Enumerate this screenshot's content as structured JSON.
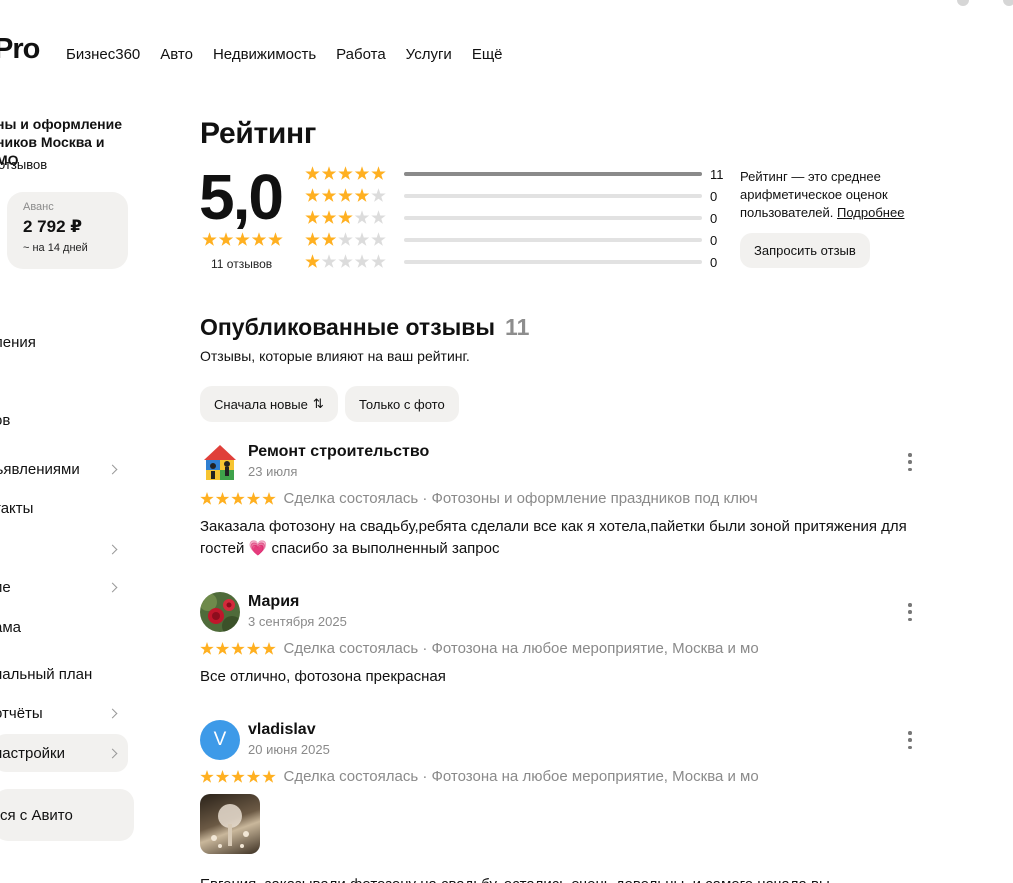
{
  "header": {
    "logo": "Pro",
    "nav": [
      "Бизнес360",
      "Авто",
      "Недвижимость",
      "Работа",
      "Услуги",
      "Ещё"
    ]
  },
  "sidebar": {
    "business_name": "ны и оформление ников Москва и МО",
    "reviews_count": "отзывов",
    "balance": {
      "label": "Аванс",
      "amount": "2 792 ₽",
      "note": "~ на 14 дней"
    },
    "items": [
      {
        "label": "ления",
        "chevron": false,
        "active": false
      },
      {
        "label": "ов",
        "chevron": false,
        "active": false
      },
      {
        "label": "ъявлениями",
        "chevron": true,
        "active": false
      },
      {
        "label": "такт ов",
        "chevron": false,
        "active": false
      },
      {
        "label": "",
        "chevron": true,
        "active": false
      },
      {
        "label": "ие",
        "chevron": true,
        "active": false
      },
      {
        "label": "ама",
        "chevron": false,
        "active": false
      },
      {
        "label": "нальный план",
        "chevron": false,
        "active": false
      },
      {
        "label": "отчёты",
        "chevron": true,
        "active": false
      },
      {
        "label": "настройки",
        "chevron": true,
        "active": true
      }
    ],
    "contact_button": "ся с Авито"
  },
  "rating": {
    "title": "Рейтинг",
    "value": "5,0",
    "stars": 5,
    "count_label": "11 отзывов",
    "distribution": [
      {
        "stars": 5,
        "count": "11",
        "fraction": 1.0
      },
      {
        "stars": 4,
        "count": "0",
        "fraction": 0
      },
      {
        "stars": 3,
        "count": "0",
        "fraction": 0
      },
      {
        "stars": 2,
        "count": "0",
        "fraction": 0
      },
      {
        "stars": 1,
        "count": "0",
        "fraction": 0
      }
    ],
    "note": "Рейтинг — это среднее арифметическое оценок пользователей.",
    "note_link": "Подробнее",
    "request_button": "Запросить отзыв"
  },
  "published": {
    "title": "Опубликованные отзывы",
    "count": "11",
    "subtitle": "Отзывы, которые влияют на ваш рейтинг.",
    "filters": {
      "sort": "Сначала новые",
      "sort_icon": "⇅",
      "photo": "Только с фото"
    }
  },
  "reviews": [
    {
      "name": "Ремонт строительство",
      "date": "23 июля",
      "avatar": "house-logo",
      "stars": 5,
      "deal": "Сделка состоялась",
      "service": "Фотозоны и оформление праздников под ключ",
      "text": "Заказала фотозону на свадьбу,ребята сделали все как я хотела,пайетки были зоной притяжения для гостей",
      "emoji": "💗",
      "text_tail": "спасибо за выполненный запрос"
    },
    {
      "name": "Мария",
      "date": "3 сентября 2025",
      "avatar": "rose-photo",
      "stars": 5,
      "deal": "Сделка состоялась",
      "service": "Фотозона на любое мероприятие, Москва и мо",
      "text": "Все отлично, фотозона прекрасная"
    },
    {
      "name": "vladislav",
      "date": "20 июня 2025",
      "avatar_letter": "V",
      "stars": 5,
      "deal": "Сделка состоялась",
      "service": "Фотозона на любое мероприятие, Москва и мо",
      "photo": "review-photo"
    }
  ],
  "clipped_text": "Евгения, заказывали фотозону на свадьбу, остались очень довольны, и самого начала вы",
  "colors": {
    "star": "#ffb021",
    "star_empty": "#dcdcdc",
    "chip_bg": "#f2f1ef",
    "avatar_blue": "#3d9ae8"
  }
}
